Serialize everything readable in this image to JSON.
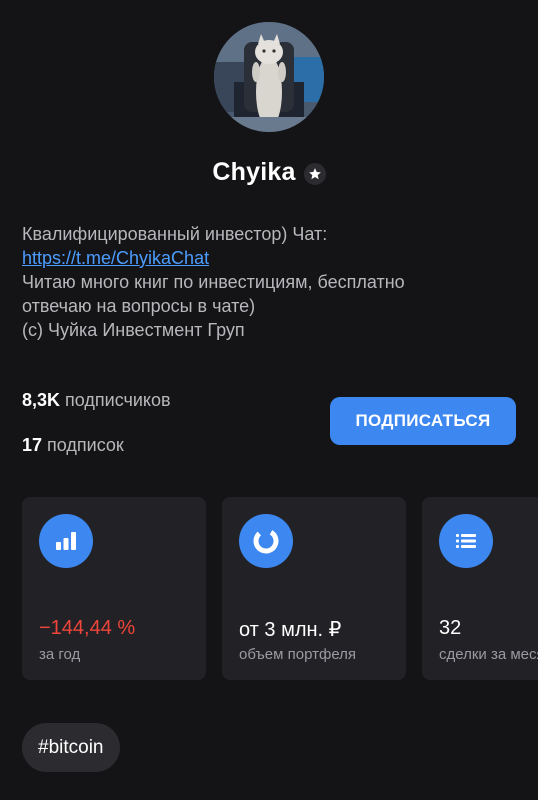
{
  "profile": {
    "name": "Chyika",
    "bio_line1": "Квалифицированный инвестор) Чат:",
    "bio_link": "https://t.me/ChyikaChat",
    "bio_line2": "Читаю много книг по инвестициям, бесплатно",
    "bio_line3": "отвечаю на вопросы в чате)",
    "bio_line4": "(c) Чуйка Инвестмент Груп"
  },
  "stats": {
    "subscribers_count": "8,3K",
    "subscribers_label": "подписчиков",
    "subscriptions_count": "17",
    "subscriptions_label": "подписок"
  },
  "subscribe_button": "ПОДПИСАТЬСЯ",
  "cards": [
    {
      "icon": "bar-chart-icon",
      "value": "−144,44 %",
      "label": "за год",
      "value_color": "#f0453a"
    },
    {
      "icon": "donut-chart-icon",
      "value": "от 3 млн. ₽",
      "label": "объем портфеля"
    },
    {
      "icon": "list-icon",
      "value": "32",
      "label": "сделки за месяц"
    }
  ],
  "tags": [
    "#bitcoin"
  ],
  "colors": {
    "accent": "#3d87f0",
    "negative": "#f0453a",
    "link": "#4b9dff",
    "background": "#141416",
    "card": "#222226"
  }
}
